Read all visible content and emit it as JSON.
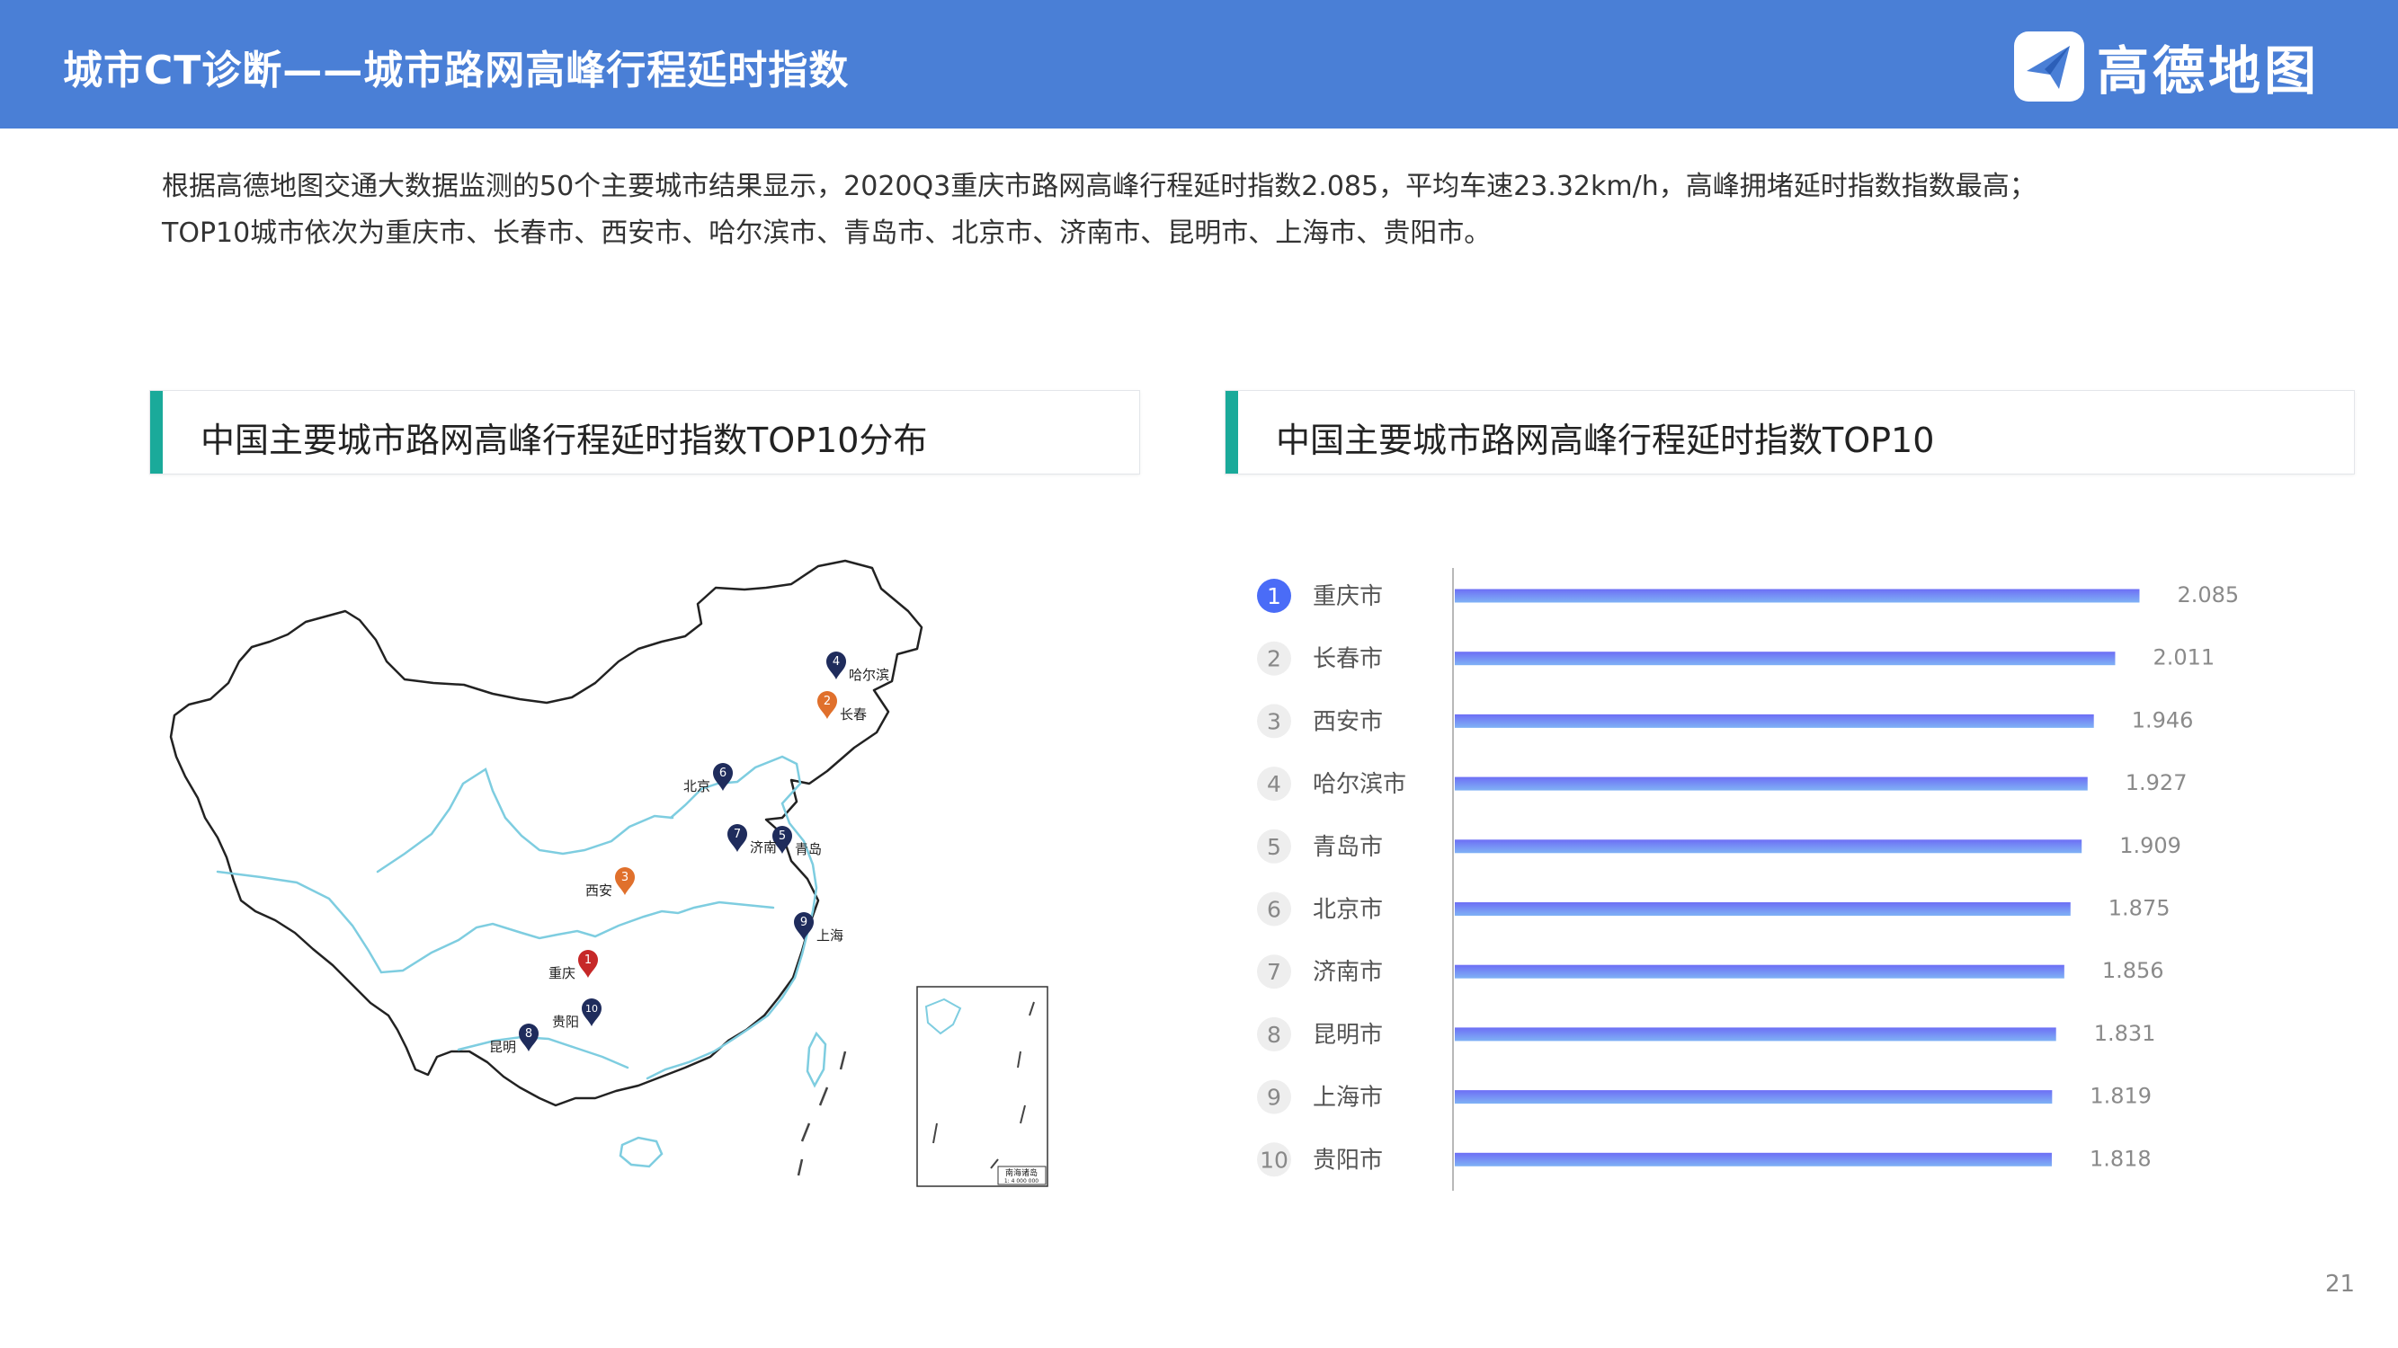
{
  "header": {
    "title": "城市CT诊断——城市路网高峰行程延时指数",
    "logo_text": "高德地图"
  },
  "summary": {
    "line1": "根据高德地图交通大数据监测的50个主要城市结果显示，2020Q3重庆市路网高峰行程延时指数2.085，平均车速23.32km/h，高峰拥堵延时指数指数最高；",
    "line2": "TOP10城市依次为重庆市、长春市、西安市、哈尔滨市、青岛市、北京市、济南市、昆明市、上海市、贵阳市。"
  },
  "map_panel": {
    "title": "中国主要城市路网高峰行程延时指数TOP10分布",
    "inset_label": "南海诸岛",
    "inset_scale": "1: 4 000 000",
    "markers": [
      {
        "rank": "1",
        "name": "重庆",
        "color": "#c62828"
      },
      {
        "rank": "2",
        "name": "长春",
        "color": "#e0702c"
      },
      {
        "rank": "3",
        "name": "西安",
        "color": "#e0702c"
      },
      {
        "rank": "4",
        "name": "哈尔滨",
        "color": "#1f2c5c"
      },
      {
        "rank": "5",
        "name": "青岛",
        "color": "#1f2c5c"
      },
      {
        "rank": "6",
        "name": "北京",
        "color": "#1f2c5c"
      },
      {
        "rank": "7",
        "name": "济南",
        "color": "#1f2c5c"
      },
      {
        "rank": "8",
        "name": "昆明",
        "color": "#1f2c5c"
      },
      {
        "rank": "9",
        "name": "上海",
        "color": "#1f2c5c"
      },
      {
        "rank": "10",
        "name": "贵阳",
        "color": "#1f2c5c"
      }
    ]
  },
  "chart_panel": {
    "title": "中国主要城市路网高峰行程延时指数TOP10"
  },
  "chart_data": {
    "type": "bar",
    "orientation": "horizontal",
    "ranks": [
      "1",
      "2",
      "3",
      "4",
      "5",
      "6",
      "7",
      "8",
      "9",
      "10"
    ],
    "categories": [
      "重庆市",
      "长春市",
      "西安市",
      "哈尔滨市",
      "青岛市",
      "北京市",
      "济南市",
      "昆明市",
      "上海市",
      "贵阳市"
    ],
    "values": [
      2.085,
      2.011,
      1.946,
      1.927,
      1.909,
      1.875,
      1.856,
      1.831,
      1.819,
      1.818
    ],
    "value_labels": [
      "2.085",
      "2.011",
      "1.946",
      "1.927",
      "1.909",
      "1.875",
      "1.856",
      "1.831",
      "1.819",
      "1.818"
    ],
    "xlim": [
      0,
      2.3
    ],
    "gradient": [
      "#6d6ef5",
      "#7fb2f5"
    ],
    "highlight_rank_color": "#4a6cf7",
    "grid": false
  },
  "page_number": "21"
}
